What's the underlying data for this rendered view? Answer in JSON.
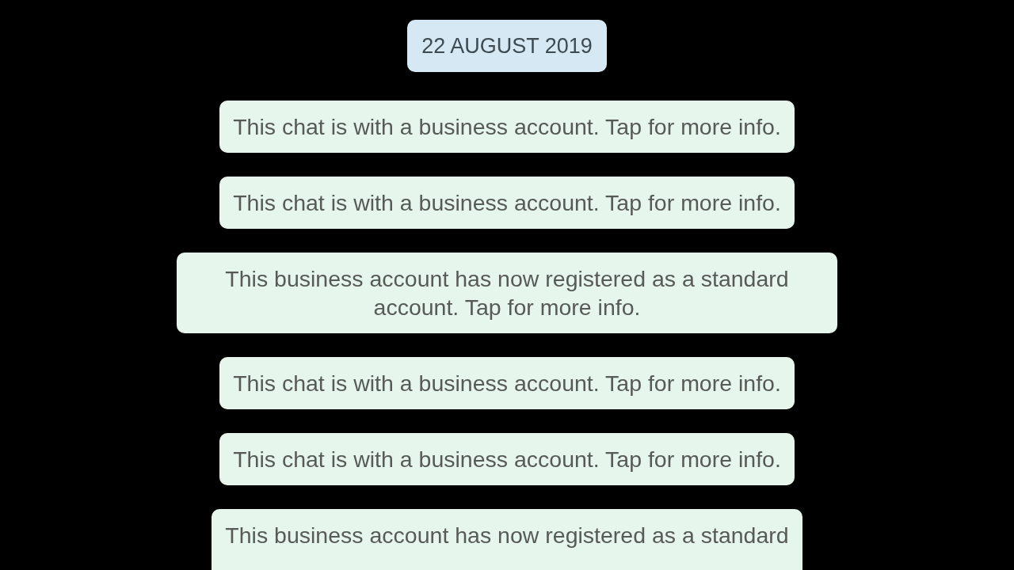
{
  "date": "22 AUGUST 2019",
  "messages": [
    {
      "text": "This chat is with a business account. Tap for more info."
    },
    {
      "text": "This chat is with a business account. Tap for more info."
    },
    {
      "text": "This business account has now registered as a standard account. Tap for more info."
    },
    {
      "text": "This chat is with a business account. Tap for more info."
    },
    {
      "text": "This chat is with a business account. Tap for more info."
    },
    {
      "text": "This business account has now registered as a standard"
    }
  ]
}
